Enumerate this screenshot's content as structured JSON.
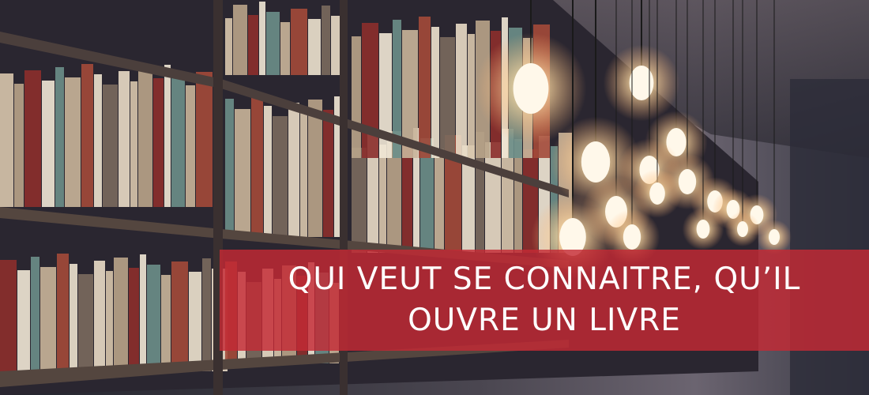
{
  "banner": {
    "line1": "QUI VEUT SE CONNAITRE, QU’IL",
    "line2": "OUVRE UN LIVRE"
  },
  "colors": {
    "banner_bg": "#c42a34",
    "banner_text": "#ffffff",
    "background": "#2a2a33"
  },
  "scene_icons": [
    "bookshelf",
    "hanging-light-bulbs"
  ]
}
